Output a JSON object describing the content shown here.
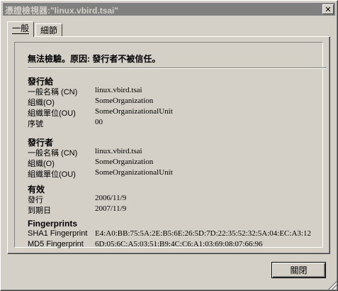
{
  "window": {
    "title": "憑證檢視器:\"linux.vbird.tsai\""
  },
  "tabs": [
    {
      "label": "一般"
    },
    {
      "label": "細節"
    }
  ],
  "general": {
    "status": "無法檢驗。原因: 發行者不被信任。",
    "issued_to": {
      "title": "發行給",
      "rows": [
        {
          "label": "一般名稱 (CN)",
          "value": "linux.vbird.tsai"
        },
        {
          "label": "組織(O)",
          "value": "SomeOrganization"
        },
        {
          "label": "組織單位(OU)",
          "value": "SomeOrganizationalUnit"
        },
        {
          "label": "序號",
          "value": "00"
        }
      ]
    },
    "issued_by": {
      "title": "發行者",
      "rows": [
        {
          "label": "一般名稱 (CN)",
          "value": "linux.vbird.tsai"
        },
        {
          "label": "組織(O)",
          "value": "SomeOrganization"
        },
        {
          "label": "組織單位(OU)",
          "value": "SomeOrganizationalUnit"
        }
      ]
    },
    "validity": {
      "title": "有效",
      "rows": [
        {
          "label": "發行",
          "value": "2006/11/9"
        },
        {
          "label": "到期日",
          "value": "2007/11/9"
        }
      ]
    },
    "fingerprints": {
      "title": "Fingerprints",
      "rows": [
        {
          "label": "SHA1 Fingerprint",
          "value": "E4:A0:BB:75:5A:2E:B5:6E:26:5D:7D:22:35:52:32:5A:04:EC:A3:12"
        },
        {
          "label": "MD5 Fingerprint",
          "value": "6D:05:6C:A5:03:51:B9:4C:C6:A1:03:69:08:07:66:96"
        }
      ]
    }
  },
  "footer": {
    "close_label": "關閉"
  },
  "icons": {
    "close": "close-icon",
    "resize": "resize-grip-icon"
  },
  "colors": {
    "titlebar_inactive": "#808080",
    "face": "#d4d0c8"
  }
}
